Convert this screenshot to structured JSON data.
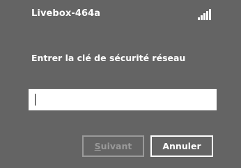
{
  "network": {
    "ssid": "Livebox-464a",
    "signal_icon": "wifi-signal-bars-icon"
  },
  "dialog": {
    "prompt": "Entrer la clé de sécurité réseau",
    "key_value": "",
    "buttons": {
      "next_label": "Suivant",
      "next_mnemonic": "S",
      "cancel_label": "Annuler"
    }
  },
  "colors": {
    "background": "#646464",
    "text": "#ffffff",
    "disabled": "#9a9a9a"
  }
}
